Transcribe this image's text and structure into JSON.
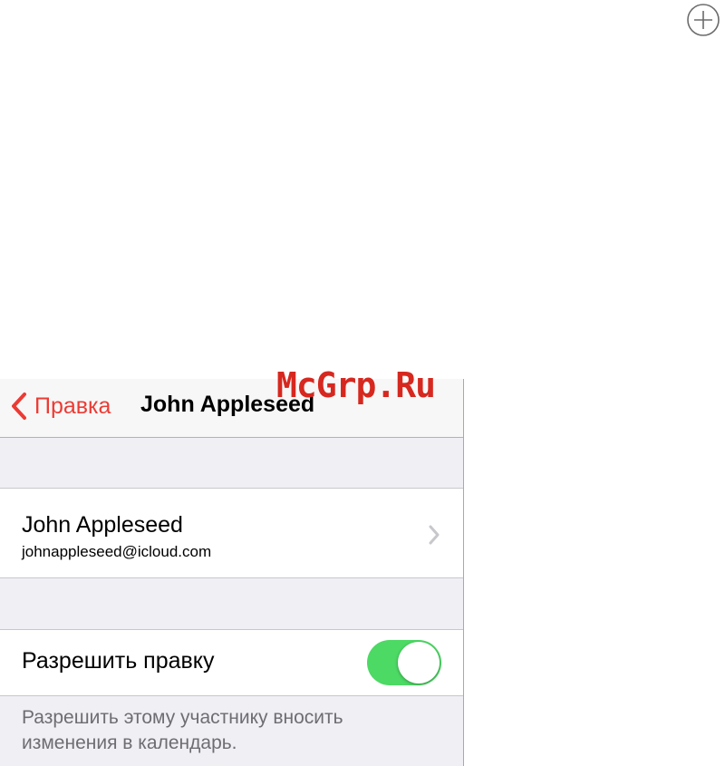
{
  "watermark": "McGrp.Ru",
  "navbar": {
    "back_label": "Правка",
    "title": "John Appleseed"
  },
  "contact": {
    "name": "John Appleseed",
    "email": "johnappleseed@icloud.com"
  },
  "permission": {
    "label": "Разрешить правку",
    "enabled": true,
    "description": "Разрешить этому участнику вносить изменения в календарь."
  },
  "colors": {
    "accent": "#ec3b34",
    "toggle_on": "#4cd964",
    "watermark": "#d6281f"
  },
  "icons": [
    "add-circle-icon",
    "chevron-left-icon",
    "chevron-right-icon"
  ]
}
